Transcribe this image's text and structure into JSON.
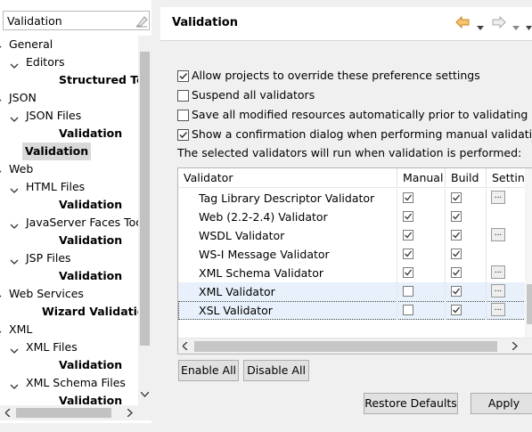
{
  "filter": {
    "value": "Validation"
  },
  "tree": {
    "items": [
      {
        "label": "General"
      },
      {
        "label": "Editors"
      },
      {
        "label": "Structured Text"
      },
      {
        "label": "JSON"
      },
      {
        "label": "JSON Files"
      },
      {
        "label": "Validation"
      },
      {
        "label": "Validation"
      },
      {
        "label": "Web"
      },
      {
        "label": "HTML Files"
      },
      {
        "label": "Validation"
      },
      {
        "label": "JavaServer Faces Tools"
      },
      {
        "label": "Validation"
      },
      {
        "label": "JSP Files"
      },
      {
        "label": "Validation"
      },
      {
        "label": "Web Services"
      },
      {
        "label": "Wizard Validation"
      },
      {
        "label": "XML"
      },
      {
        "label": "XML Files"
      },
      {
        "label": "Validation"
      },
      {
        "label": "XML Schema Files"
      },
      {
        "label": "Validation"
      }
    ]
  },
  "page": {
    "title": "Validation"
  },
  "options": [
    {
      "label": "Allow projects to override these preference settings",
      "checked": true
    },
    {
      "label": "Suspend all validators",
      "checked": false
    },
    {
      "label": "Save all modified resources automatically prior to validating",
      "checked": false
    },
    {
      "label": "Show a confirmation dialog when performing manual validations",
      "checked": true
    }
  ],
  "info_text": "The selected validators will run when validation is performed:",
  "table": {
    "columns": [
      "Validator",
      "Manual",
      "Build",
      "Settings"
    ],
    "rows": [
      {
        "name": "Tag Library Descriptor Validator",
        "manual": true,
        "build": true,
        "settings": true
      },
      {
        "name": "Web (2.2-2.4) Validator",
        "manual": true,
        "build": true,
        "settings": false
      },
      {
        "name": "WSDL Validator",
        "manual": true,
        "build": true,
        "settings": true
      },
      {
        "name": "WS-I Message Validator",
        "manual": true,
        "build": true,
        "settings": false
      },
      {
        "name": "XML Schema Validator",
        "manual": true,
        "build": true,
        "settings": true
      },
      {
        "name": "XML Validator",
        "manual": false,
        "build": true,
        "settings": true
      },
      {
        "name": "XSL Validator",
        "manual": false,
        "build": true,
        "settings": true
      }
    ]
  },
  "buttons": {
    "enable_all": "Enable All",
    "disable_all": "Disable All",
    "restore_defaults": "Restore Defaults",
    "apply": "Apply",
    "settings_btn": "..."
  },
  "icons": {
    "back": "back-arrow-icon",
    "forward": "forward-arrow-icon",
    "menu": "view-menu-icon",
    "clear": "clear-filter-icon"
  },
  "colors": {
    "back_arrow": "#e8a33d",
    "check": "#333333",
    "selection": "#d9d9d9",
    "row_highlight": "#e8f1fb"
  }
}
